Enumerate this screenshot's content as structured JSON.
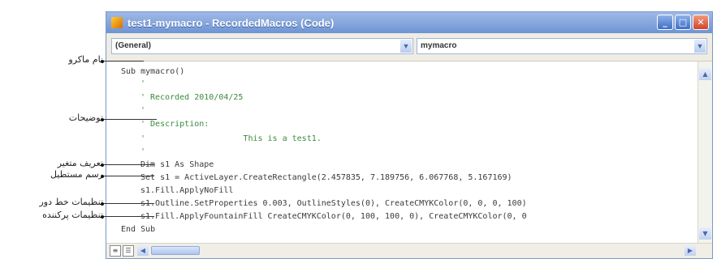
{
  "window": {
    "title": "test1-mymacro - RecordedMacros (Code)",
    "buttons": {
      "minimize": "_",
      "maximize": "□",
      "close": "✕"
    }
  },
  "dropdowns": {
    "object": "(General)",
    "procedure": "mymacro"
  },
  "code_lines": [
    {
      "text": "Sub mymacro()",
      "type": "code"
    },
    {
      "text": "'",
      "type": "comment"
    },
    {
      "text": "' Recorded 2010/04/25",
      "type": "comment"
    },
    {
      "text": "'",
      "type": "comment"
    },
    {
      "text": "' Description:",
      "type": "comment"
    },
    {
      "text": "'                    This is a test1.",
      "type": "comment"
    },
    {
      "text": "'",
      "type": "comment"
    },
    {
      "text": "Dim s1 As Shape",
      "type": "code"
    },
    {
      "text": "Set s1 = ActiveLayer.CreateRectangle(2.457835, 7.189756, 6.067768, 5.167169)",
      "type": "code"
    },
    {
      "text": "s1.Fill.ApplyNoFill",
      "type": "code"
    },
    {
      "text": "s1.Outline.SetProperties 0.003, OutlineStyles(0), CreateCMYKColor(0, 0, 0, 100)",
      "type": "code"
    },
    {
      "text": "s1.Fill.ApplyFountainFill CreateCMYKColor(0, 100, 100, 0), CreateCMYKColor(0, 0",
      "type": "code"
    },
    {
      "text": "End Sub",
      "type": "code"
    }
  ],
  "annotations": [
    {
      "label": "نام ماکرو"
    },
    {
      "label": "توضیحات"
    },
    {
      "label": "تعریف متغیر"
    },
    {
      "label": "رسم مستطیل"
    },
    {
      "label": "تنظیمات خط دور"
    },
    {
      "label": "تنظیمات پرکننده"
    }
  ],
  "icons": {
    "app": "vba-code-icon",
    "scroll_up": "▲",
    "scroll_down": "▼",
    "scroll_left": "◀",
    "scroll_right": "▶"
  },
  "colors": {
    "title_bar": "#6e94d4",
    "comment": "#3c8a3c",
    "code": "#3a3a3a"
  }
}
